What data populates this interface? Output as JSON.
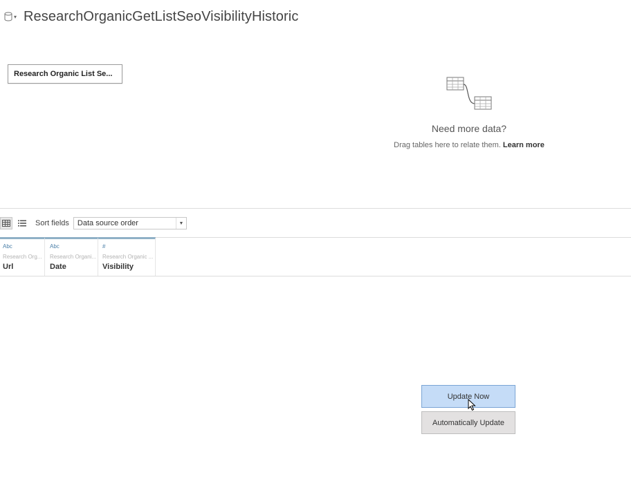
{
  "header": {
    "title": "ResearchOrganicGetListSeoVisibilityHistoric",
    "db_icon": "database-icon"
  },
  "canvas": {
    "table_pill_label": "Research Organic List Se...",
    "need_more": {
      "title": "Need more data?",
      "subtitle": "Drag tables here to relate them.",
      "learn_more": "Learn more",
      "icon": "relate-tables-icon"
    }
  },
  "toolbar": {
    "grid_view_icon": "grid-view-icon",
    "list_view_icon": "list-view-icon",
    "sort_label": "Sort fields",
    "sort_value": "Data source order"
  },
  "fields": [
    {
      "type": "Abc",
      "source": "Research Org...",
      "name": "Url"
    },
    {
      "type": "Abc",
      "source": "Research Organi...",
      "name": "Date"
    },
    {
      "type": "#",
      "source": "Research Organic ...",
      "name": "Visibility"
    }
  ],
  "actions": {
    "update_now": "Update Now",
    "auto_update": "Automatically Update"
  },
  "colors": {
    "update_button_bg": "#c5dcf7",
    "update_button_border": "#7aa4d4",
    "field_header_accent": "#8fb0c6",
    "field_type_color": "#4a7fa8"
  }
}
